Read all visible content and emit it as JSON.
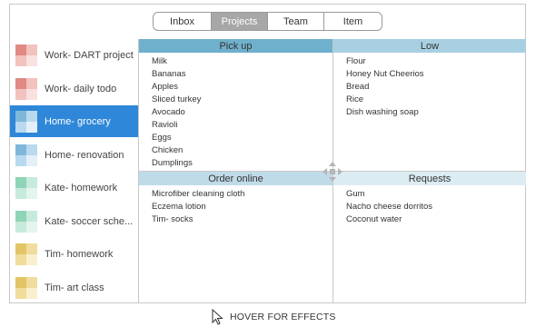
{
  "tabs": [
    {
      "label": "Inbox",
      "active": false
    },
    {
      "label": "Projects",
      "active": true
    },
    {
      "label": "Team",
      "active": false
    },
    {
      "label": "Item",
      "active": false
    }
  ],
  "sidebar": {
    "items": [
      {
        "label": "Work- DART project",
        "active": false,
        "colors": [
          "#e08a83",
          "#f2c2be",
          "#f2c2be",
          "#f9e1df"
        ]
      },
      {
        "label": "Work- daily todo",
        "active": false,
        "colors": [
          "#e08a83",
          "#f2c2be",
          "#f2c2be",
          "#f9e1df"
        ]
      },
      {
        "label": "Home- grocery",
        "active": true,
        "colors": [
          "#7fb7da",
          "#b9d9ee",
          "#b9d9ee",
          "#e3f0f8"
        ]
      },
      {
        "label": "Home- renovation",
        "active": false,
        "colors": [
          "#7fb7da",
          "#b9d9ee",
          "#b9d9ee",
          "#e3f0f8"
        ]
      },
      {
        "label": "Kate- homework",
        "active": false,
        "colors": [
          "#8fd4b6",
          "#c6eadb",
          "#c6eadb",
          "#e4f5ed"
        ]
      },
      {
        "label": "Kate- soccer sche...",
        "active": false,
        "colors": [
          "#8fd4b6",
          "#c6eadb",
          "#c6eadb",
          "#e4f5ed"
        ]
      },
      {
        "label": "Tim- homework",
        "active": false,
        "colors": [
          "#e3c466",
          "#f0dc9c",
          "#f0dc9c",
          "#f8efcc"
        ]
      },
      {
        "label": "Tim- art class",
        "active": false,
        "colors": [
          "#e3c466",
          "#f0dc9c",
          "#f0dc9c",
          "#f8efcc"
        ]
      }
    ]
  },
  "quadrants": {
    "pickup": {
      "title": "Pick up",
      "color": "#6fb0cc",
      "items": [
        "Milk",
        "Bananas",
        "Apples",
        "Sliced turkey",
        "Avocado",
        "Ravioli",
        "Eggs",
        "Chicken",
        "Dumplings"
      ]
    },
    "low": {
      "title": "Low",
      "color": "#a9d0e2",
      "items": [
        "Flour",
        "Honey Nut Cheerios",
        "Bread",
        "Rice",
        "Dish washing soap"
      ]
    },
    "online": {
      "title": "Order online",
      "color": "#c0dbe8",
      "items": [
        "Microfiber cleaning cloth",
        "Eczema lotion",
        "Tim- socks"
      ]
    },
    "requests": {
      "title": "Requests",
      "color": "#dcecf3",
      "items": [
        "Gum",
        "Nacho cheese dorritos",
        "Coconut water"
      ]
    }
  },
  "hover_hint": "HOVER FOR EFFECTS",
  "icons": {
    "move": "move-arrows-icon",
    "cursor": "mouse-pointer-icon"
  }
}
